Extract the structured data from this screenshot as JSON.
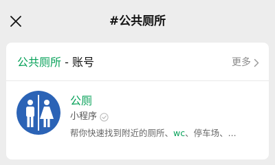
{
  "topbar": {
    "close_icon": "close-icon",
    "title": "#公共厕所"
  },
  "card": {
    "header": {
      "keyword": "公共厕所",
      "suffix": " - 账号",
      "more_label": "更多",
      "more_icon": "chevron-right-icon"
    },
    "result": {
      "name": "公厕",
      "type_label": "小程序",
      "verified_icon": "verified-badge-icon",
      "desc_before": "帮你快速找到附近的厕所、",
      "desc_highlight": "wc",
      "desc_after": "、停车场、..."
    }
  },
  "colors": {
    "accent": "#07A159",
    "logo_bg": "#2B63B6",
    "background": "#EDEDED"
  }
}
